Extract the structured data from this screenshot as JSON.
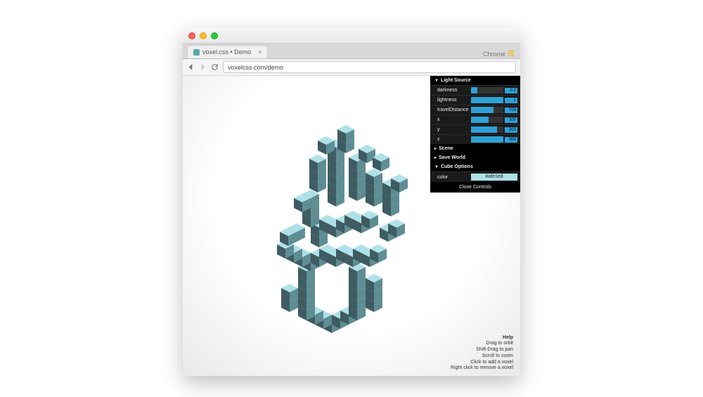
{
  "browser": {
    "tab_title": "voxel.css • Demo",
    "url": "voxelcss.com/demo",
    "browser_name": "Chrome"
  },
  "panel": {
    "sections": {
      "light_source": {
        "title": "Light Source",
        "rows": [
          {
            "label": "darkness",
            "value": "0.2",
            "fill": 20
          },
          {
            "label": "lightness",
            "value": "1",
            "fill": 100
          },
          {
            "label": "travelDistance",
            "value": "700",
            "fill": 70
          },
          {
            "label": "x",
            "value": "300",
            "fill": 55
          },
          {
            "label": "y",
            "value": "300",
            "fill": 80
          },
          {
            "label": "z",
            "value": "300",
            "fill": 100
          }
        ]
      },
      "scene": {
        "title": "Scene"
      },
      "save_world": {
        "title": "Save World"
      },
      "cube_options": {
        "title": "Cube Options",
        "color_label": "color",
        "color_value": "#afe1e8"
      }
    },
    "close": "Close Controls"
  },
  "help": {
    "heading": "Help",
    "lines": [
      "Drag to orbit",
      "Shift-Drag to pan",
      "Scroll to zoom",
      "Click to add a voxel",
      "Right click to remove a voxel"
    ]
  },
  "colors": {
    "voxel_light": "#afe1e8",
    "voxel_mid": "#5f8d94",
    "voxel_dark": "#3e5c61",
    "voxel_darker": "#2c4449"
  }
}
